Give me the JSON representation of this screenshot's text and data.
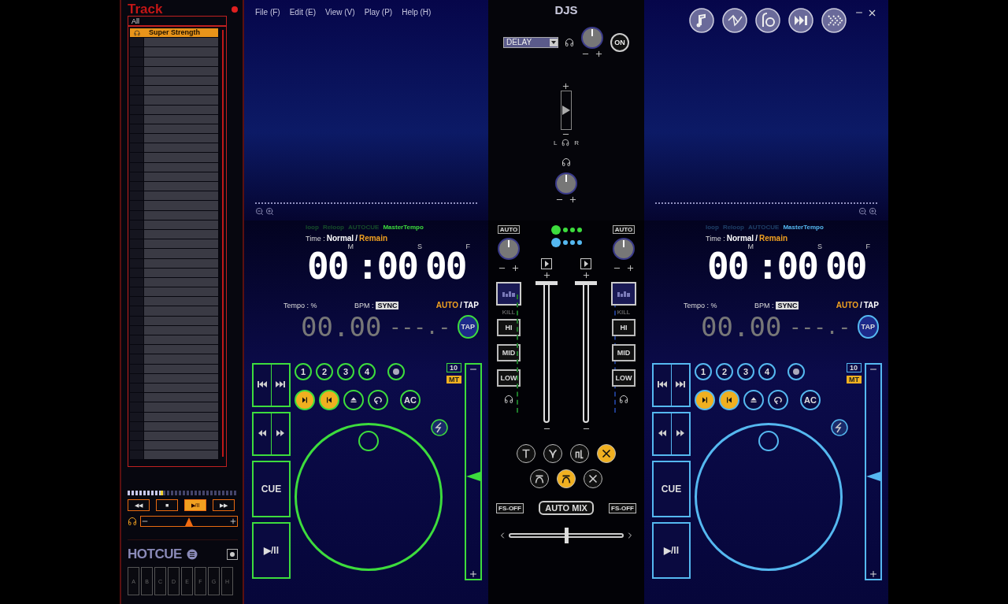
{
  "track_panel": {
    "title": "Track",
    "filter": "All",
    "tracks": [
      {
        "title": "Super Strength",
        "selected": true
      }
    ],
    "position": {
      "level": 0.3
    },
    "transport": [
      {
        "label": "◀◀",
        "selected": false
      },
      {
        "label": "■",
        "selected": false
      },
      {
        "label": "▶/II",
        "selected": true
      },
      {
        "label": "▶▶",
        "selected": false
      }
    ],
    "volume": {
      "level": 0.5
    },
    "hotcue": {
      "title": "HOTCUE",
      "keys": [
        "A",
        "B",
        "C",
        "D",
        "E",
        "F",
        "G",
        "H"
      ]
    }
  },
  "menu": [
    "File (F)",
    "Edit (E)",
    "View (V)",
    "Play (P)",
    "Help (H)"
  ],
  "title": "DJS",
  "effect": {
    "name": "DELAY",
    "on": "ON"
  },
  "master": {
    "left": "L",
    "right": "R",
    "level": 0.5
  },
  "decks": [
    {
      "color": "#3ddc3d",
      "flags": [
        {
          "label": "loop",
          "on": false
        },
        {
          "label": "Reloop",
          "on": false
        },
        {
          "label": "AUTOCUE",
          "on": false
        },
        {
          "label": "MasterTempo",
          "on": true
        }
      ],
      "time_label": "Time :",
      "mode_separator": "/",
      "time_modes": [
        {
          "label": "Normal",
          "selected": false
        },
        {
          "label": "Remain",
          "selected": true
        }
      ],
      "time_separator": ":",
      "time": [
        {
          "digits": "00",
          "unit": "M"
        },
        {
          "digits": "00",
          "unit": "S"
        },
        {
          "digits": "00",
          "unit": "F"
        }
      ],
      "tempo_label": "Tempo : %",
      "tempo": "00.00",
      "bpm_label": "BPM :",
      "sync": "SYNC",
      "bpm_modes": [
        {
          "label": "AUTO",
          "selected": true
        },
        {
          "label": "TAP",
          "selected": false
        }
      ],
      "bpm": "---.-",
      "tap": "TAP",
      "hotcues": [
        "1",
        "2",
        "3",
        "4"
      ],
      "buttons": [
        {
          "kind": "next",
          "on": true
        },
        {
          "kind": "prev",
          "on": true
        },
        {
          "kind": "eject",
          "on": false
        },
        {
          "kind": "loop",
          "on": false
        }
      ],
      "ac": "AC",
      "pitch_range": "10",
      "mt": "MT",
      "cue": "CUE",
      "play": "▶/II",
      "pitch": {
        "level": 0.5
      }
    },
    {
      "color": "#55b8f0",
      "flags": [
        {
          "label": "loop",
          "on": false
        },
        {
          "label": "Reloop",
          "on": false
        },
        {
          "label": "AUTOCUE",
          "on": false
        },
        {
          "label": "MasterTempo",
          "on": true
        }
      ],
      "time_label": "Time :",
      "mode_separator": "/",
      "time_modes": [
        {
          "label": "Normal",
          "selected": false
        },
        {
          "label": "Remain",
          "selected": true
        }
      ],
      "time_separator": ":",
      "time": [
        {
          "digits": "00",
          "unit": "M"
        },
        {
          "digits": "00",
          "unit": "S"
        },
        {
          "digits": "00",
          "unit": "F"
        }
      ],
      "tempo_label": "Tempo : %",
      "tempo": "00.00",
      "bpm_label": "BPM :",
      "sync": "SYNC",
      "bpm_modes": [
        {
          "label": "AUTO",
          "selected": true
        },
        {
          "label": "TAP",
          "selected": false
        }
      ],
      "bpm": "---.-",
      "tap": "TAP",
      "hotcues": [
        "1",
        "2",
        "3",
        "4"
      ],
      "buttons": [
        {
          "kind": "next",
          "on": true
        },
        {
          "kind": "prev",
          "on": true
        },
        {
          "kind": "eject",
          "on": false
        },
        {
          "kind": "loop",
          "on": false
        }
      ],
      "ac": "AC",
      "pitch_range": "10",
      "mt": "MT",
      "cue": "CUE",
      "play": "▶/II",
      "pitch": {
        "level": 0.5
      }
    }
  ],
  "mixer": {
    "channels": [
      {
        "auto": "AUTO",
        "kill": "KILL",
        "eq": [
          "HI",
          "MID",
          "LOW"
        ],
        "fs": "FS-OFF",
        "fader": {
          "level": 1
        }
      },
      {
        "auto": "AUTO",
        "kill": "KILL",
        "eq": [
          "HI",
          "MID",
          "LOW"
        ],
        "fs": "FS-OFF",
        "fader": {
          "level": 1
        }
      }
    ],
    "curves": [
      {
        "kind": "tee",
        "selected": false
      },
      {
        "kind": "fork",
        "selected": false
      },
      {
        "kind": "step",
        "selected": false
      },
      {
        "kind": "cross",
        "selected": true
      },
      {
        "kind": "arch",
        "selected": false
      },
      {
        "kind": "arch",
        "selected": true
      },
      {
        "kind": "cross",
        "selected": false
      }
    ],
    "automix": "AUTO MIX",
    "crossfader": {
      "level": 0.5
    }
  }
}
